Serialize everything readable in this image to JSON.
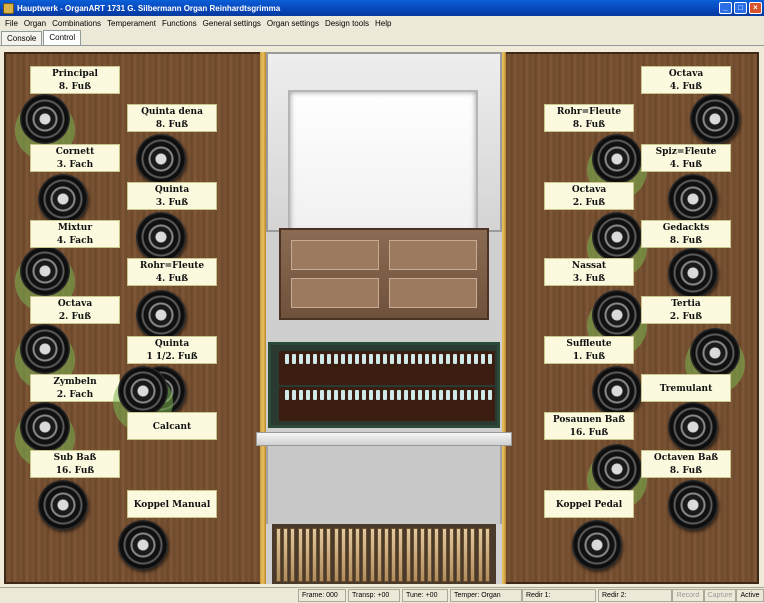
{
  "window": {
    "title": "Hauptwerk - OrganART 1731 G. Silbermann Organ Reinhardtsgrimma"
  },
  "menu": [
    "File",
    "Organ",
    "Combinations",
    "Temperament",
    "Functions",
    "General settings",
    "Organ settings",
    "Design tools",
    "Help"
  ],
  "tabs": [
    "Console",
    "Control"
  ],
  "stops_left_outer": [
    {
      "name": "Principal",
      "size": "8. Fuß"
    },
    {
      "name": "Cornett",
      "size": "3. Fach"
    },
    {
      "name": "Mixtur",
      "size": "4. Fach"
    },
    {
      "name": "Octava",
      "size": "2. Fuß"
    },
    {
      "name": "Zymbeln",
      "size": "2. Fach"
    },
    {
      "name": "Sub Baß",
      "size": "16. Fuß"
    }
  ],
  "stops_left_inner": [
    {
      "name": "Quinta dena",
      "size": "8. Fuß"
    },
    {
      "name": "Quinta",
      "size": "3. Fuß"
    },
    {
      "name": "Rohr=Fleute",
      "size": "4. Fuß"
    },
    {
      "name": "Quinta",
      "size": "1 1/2. Fuß"
    },
    {
      "name": "Calcant",
      "size": ""
    },
    {
      "name": "Koppel Manual",
      "size": ""
    }
  ],
  "stops_right_inner": [
    {
      "name": "Rohr=Fleute",
      "size": "8. Fuß"
    },
    {
      "name": "Octava",
      "size": "2. Fuß"
    },
    {
      "name": "Nassat",
      "size": "3. Fuß"
    },
    {
      "name": "Suffleute",
      "size": "1. Fuß"
    },
    {
      "name": "Posaunen Baß",
      "size": "16. Fuß"
    },
    {
      "name": "Koppel Pedal",
      "size": ""
    }
  ],
  "stops_right_outer": [
    {
      "name": "Octava",
      "size": "4. Fuß"
    },
    {
      "name": "Spiz=Fleute",
      "size": "4. Fuß"
    },
    {
      "name": "Gedackts",
      "size": "8. Fuß"
    },
    {
      "name": "Tertia",
      "size": "2. Fuß"
    },
    {
      "name": "Tremulant",
      "size": ""
    },
    {
      "name": "Octaven Baß",
      "size": "8. Fuß"
    }
  ],
  "status": {
    "frame": "Frame: 000",
    "transp": "Transp: +00",
    "tune": "Tune: +00",
    "temper": "Temper: Organ",
    "redir1": "Redir 1:",
    "redir2": "Redir 2:",
    "record": "Record",
    "capture": "Capture",
    "active": "Active"
  }
}
